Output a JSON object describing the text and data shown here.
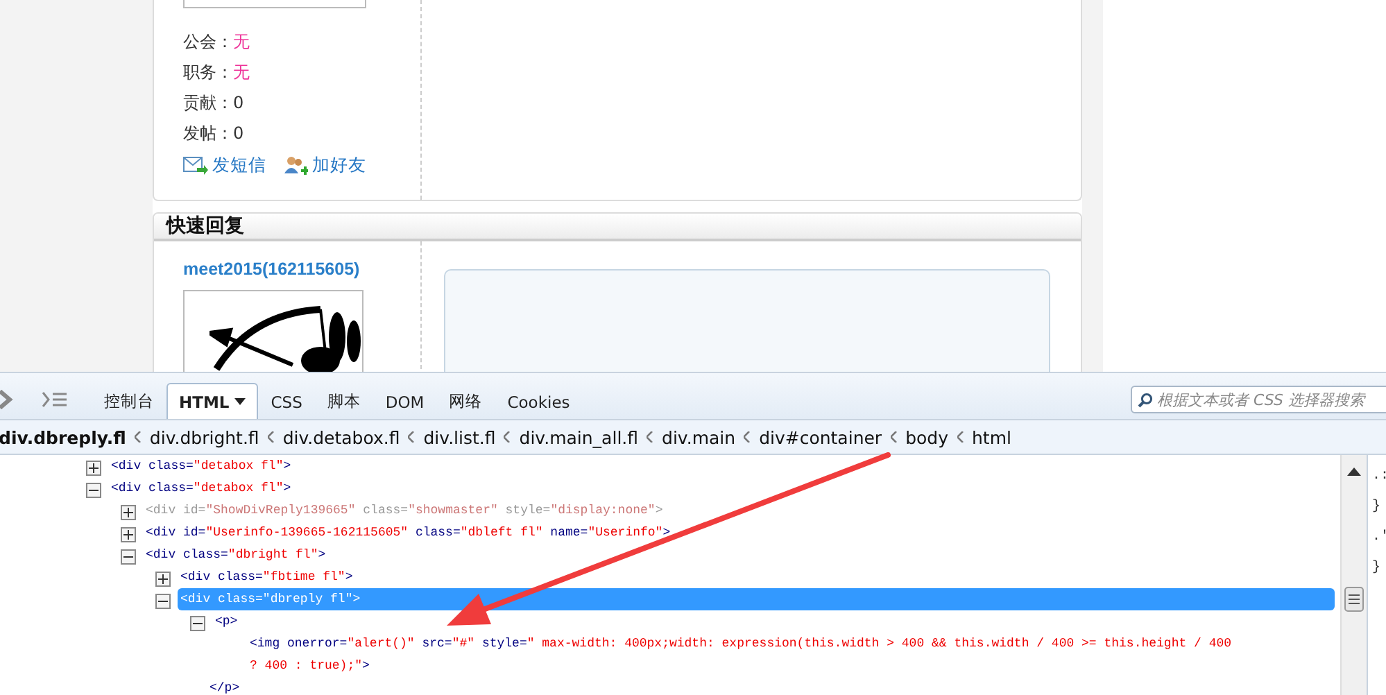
{
  "user_panel": {
    "info": [
      {
        "label": "公会：",
        "value": "无",
        "color": "#ee3399"
      },
      {
        "label": "职务：",
        "value": "无",
        "color": "#ee3399"
      },
      {
        "label": "贡献：",
        "value": "0",
        "color": "#333333"
      },
      {
        "label": "发帖：",
        "value": "0",
        "color": "#333333"
      }
    ],
    "links": [
      {
        "kind": "message",
        "label": "发短信"
      },
      {
        "kind": "friend",
        "label": "加好友"
      }
    ]
  },
  "quick_reply": {
    "title": "快速回复",
    "username": "meet2015(162115605)"
  },
  "devtools": {
    "tabs": [
      {
        "label": "控制台",
        "selected": false,
        "dropdown": false
      },
      {
        "label": "HTML",
        "selected": true,
        "dropdown": true
      },
      {
        "label": "CSS",
        "selected": false,
        "dropdown": false
      },
      {
        "label": "脚本",
        "selected": false,
        "dropdown": false
      },
      {
        "label": "DOM",
        "selected": false,
        "dropdown": false
      },
      {
        "label": "网络",
        "selected": false,
        "dropdown": false
      },
      {
        "label": "Cookies",
        "selected": false,
        "dropdown": false
      }
    ],
    "search": {
      "placeholder": "根据文本或者 CSS 选择器搜索"
    },
    "breadcrumbs": [
      "div.dbreply.fl",
      "div.dbright.fl",
      "div.detabox.fl",
      "div.list.fl",
      "div.main_all.fl",
      "div.main",
      "div#container",
      "body",
      "html"
    ],
    "tree": [
      {
        "text": "<div class=\"detabox fl\">",
        "expanded": false,
        "selected": false,
        "greyed": false
      },
      {
        "text": "<div class=\"detabox fl\">",
        "expanded": true,
        "selected": false,
        "greyed": false,
        "children": [
          {
            "text": "<div id=\"ShowDivReply139665\" class=\"showmaster\" style=\"display:none\">",
            "expanded": false,
            "selected": false,
            "greyed": true
          },
          {
            "text": "<div id=\"Userinfo-139665-162115605\" class=\"dbleft fl\" name=\"Userinfo\">",
            "expanded": false,
            "selected": false,
            "greyed": false
          },
          {
            "text": "<div class=\"dbright fl\">",
            "expanded": true,
            "selected": false,
            "greyed": false,
            "children": [
              {
                "text": "<div class=\"fbtime fl\">",
                "expanded": false,
                "selected": false,
                "greyed": false
              },
              {
                "text": "<div class=\"dbreply fl\">",
                "expanded": true,
                "selected": true,
                "greyed": false,
                "children": [
                  {
                    "text": "<p>",
                    "expanded": true,
                    "selected": false,
                    "greyed": false,
                    "closing": "</p>",
                    "children": [
                      {
                        "text": "<img onerror=\"alert()\" src=\"#\" style=\" max-width: 400px;width: expression(this.width > 400 && this.width / 400 >= this.height / 400 ? 400 : true);\">",
                        "selected": false,
                        "greyed": false
                      }
                    ]
                  }
                ]
              }
            ]
          }
        ]
      }
    ],
    "side_panel": [
      ".:",
      "}",
      ".'",
      "}"
    ]
  }
}
